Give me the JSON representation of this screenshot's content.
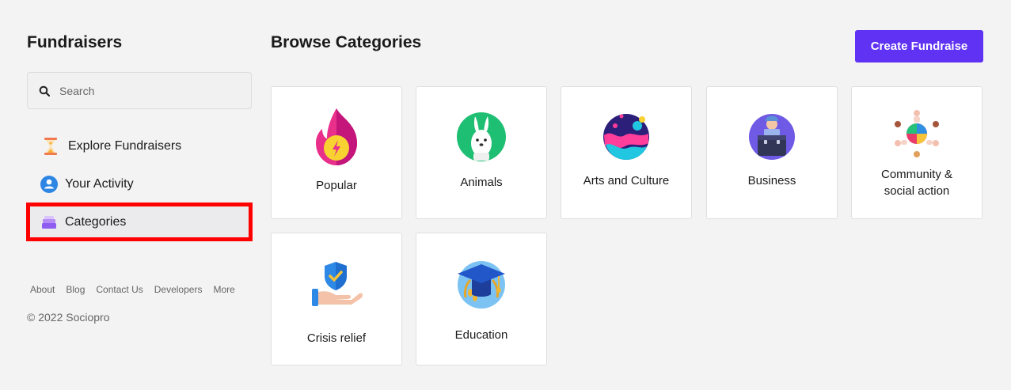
{
  "sidebar": {
    "title": "Fundraisers",
    "search": {
      "placeholder": "Search",
      "value": ""
    },
    "items": [
      {
        "label": "Explore Fundraisers",
        "icon": "hourglass-icon"
      },
      {
        "label": "Your Activity",
        "icon": "user-circle-icon"
      },
      {
        "label": "Categories",
        "icon": "stack-icon",
        "selected": true
      }
    ],
    "footer_links": [
      "About",
      "Blog",
      "Contact Us",
      "Developers",
      "More"
    ],
    "copyright": "© 2022 Sociopro"
  },
  "main": {
    "title": "Browse Categories",
    "create_button": "Create Fundraise",
    "categories": [
      {
        "label": "Popular",
        "icon": "flame-icon"
      },
      {
        "label": "Animals",
        "icon": "rabbit-icon"
      },
      {
        "label": "Arts and Culture",
        "icon": "art-planet-icon"
      },
      {
        "label": "Business",
        "icon": "briefcase-icon"
      },
      {
        "label": "Community & social action",
        "icon": "community-icon"
      },
      {
        "label": "Crisis relief",
        "icon": "shield-hand-icon"
      },
      {
        "label": "Education",
        "icon": "graduation-cap-icon"
      }
    ]
  },
  "colors": {
    "accent": "#5f32f4",
    "highlight": "#ff0000",
    "background": "#f3f3f4"
  }
}
